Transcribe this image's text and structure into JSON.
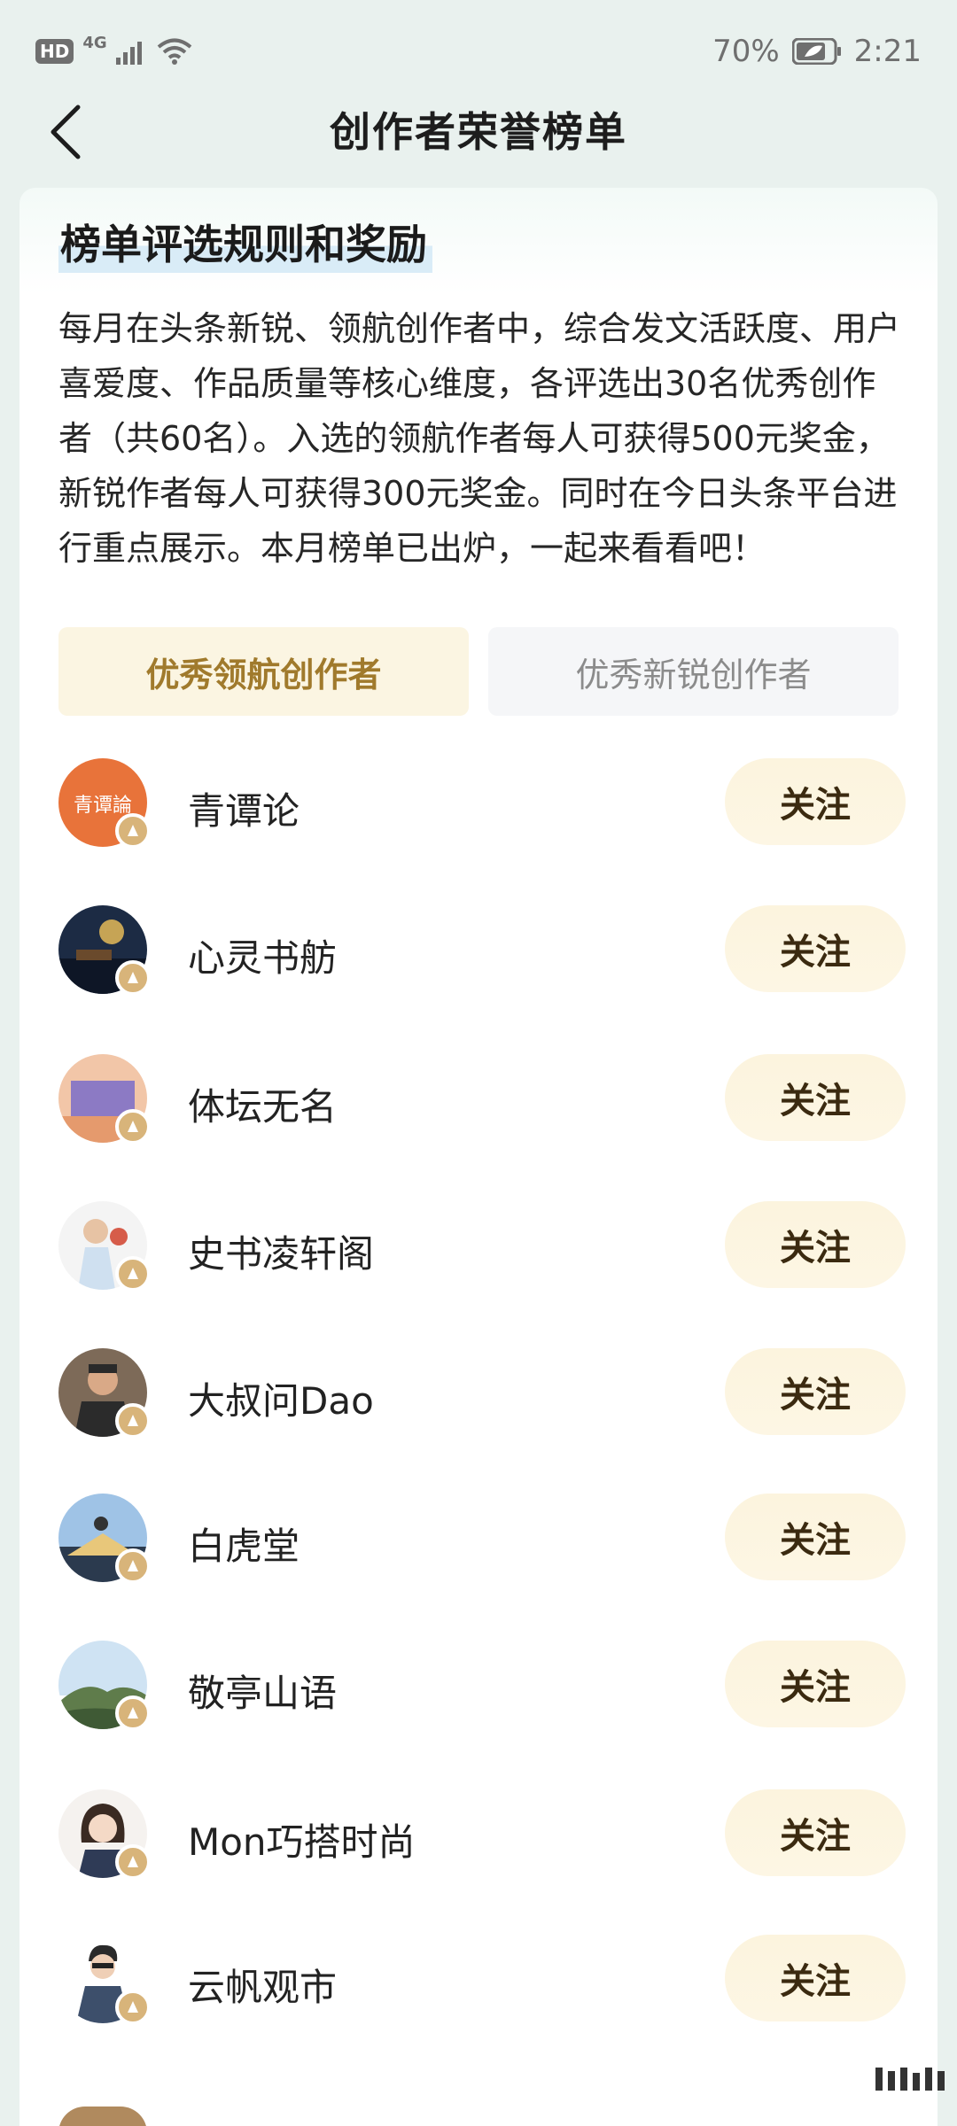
{
  "status_bar": {
    "hd": "HD",
    "network": "4G",
    "battery": "70%",
    "time": "2:21"
  },
  "header": {
    "title": "创作者荣誉榜单"
  },
  "rules": {
    "title": "榜单评选规则和奖励",
    "text": "每月在头条新锐、领航创作者中，综合发文活跃度、用户喜爱度、作品质量等核心维度，各评选出30名优秀创作者（共60名）。入选的领航作者每人可获得500元奖金，新锐作者每人可获得300元奖金。同时在今日头条平台进行重点展示。本月榜单已出炉，一起来看看吧！"
  },
  "tabs": [
    {
      "label": "优秀领航创作者",
      "active": true
    },
    {
      "label": "优秀新锐创作者",
      "active": false
    }
  ],
  "creators": [
    {
      "name": "青谭论",
      "follow_label": "关注",
      "avatar_text": "青谭論"
    },
    {
      "name": "心灵书舫",
      "follow_label": "关注"
    },
    {
      "name": "体坛无名",
      "follow_label": "关注"
    },
    {
      "name": "史书凌轩阁",
      "follow_label": "关注"
    },
    {
      "name": "大叔问Dao",
      "follow_label": "关注"
    },
    {
      "name": "白虎堂",
      "follow_label": "关注"
    },
    {
      "name": "敬亭山语",
      "follow_label": "关注"
    },
    {
      "name": "Mon巧搭时尚",
      "follow_label": "关注"
    },
    {
      "name": "云帆观市",
      "follow_label": "关注"
    }
  ],
  "colors": {
    "background": "#e9f1ee",
    "tab_active_bg": "#fbf5e2",
    "tab_active_text": "#a07a2c",
    "follow_bg": "#fcf4de",
    "badge": "#d8b47a"
  }
}
